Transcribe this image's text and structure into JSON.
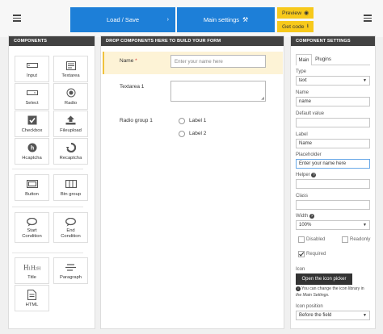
{
  "topbar": {
    "load_save": "Load / Save",
    "main_settings": "Main settings",
    "preview": "Preview",
    "get_code": "Get code"
  },
  "components": {
    "header": "COMPONENTS",
    "items": [
      "Input",
      "Textarea",
      "Select",
      "Radio",
      "Checkbox",
      "Fileupload",
      "Hcaptcha",
      "Recaptcha",
      "Button",
      "Btn group",
      "Start Condition",
      "End Condition",
      "Title",
      "Paragraph",
      "HTML"
    ]
  },
  "builder": {
    "header": "DROP COMPONENTS HERE TO BUILD YOUR FORM",
    "name_label": "Name",
    "name_required_mark": "*",
    "name_placeholder": "Enter your name here",
    "textarea_label": "Textarea 1",
    "radio_group_label": "Radio group 1",
    "radio_options": [
      "Label 1",
      "Label 2"
    ]
  },
  "settings": {
    "header": "COMPONENT SETTINGS",
    "tabs": [
      "Main",
      "Plugins"
    ],
    "type_label": "Type",
    "type_value": "text",
    "name_label": "Name",
    "name_value": "name",
    "default_label": "Default value",
    "default_value": "",
    "label_label": "Label",
    "label_value": "Name",
    "placeholder_label": "Placeholder",
    "placeholder_value": "Enter your name here",
    "helper_label": "Helper",
    "class_label": "Class",
    "width_label": "Width",
    "width_value": "100%",
    "disabled_label": "Disabled",
    "readonly_label": "Readonly",
    "required_label": "Required",
    "required_checked": true,
    "icon_label": "Icon",
    "icon_picker_button": "Open the icon picker",
    "icon_help_1": "You can change the icon library in",
    "icon_help_2": "the Main Settings.",
    "icon_position_label": "Icon position",
    "icon_position_value": "Before the field"
  },
  "colors": {
    "blue": "#1d7fd8",
    "yellow": "#f7c91b",
    "dark": "#424242",
    "highlight": "#fdf3d6"
  }
}
